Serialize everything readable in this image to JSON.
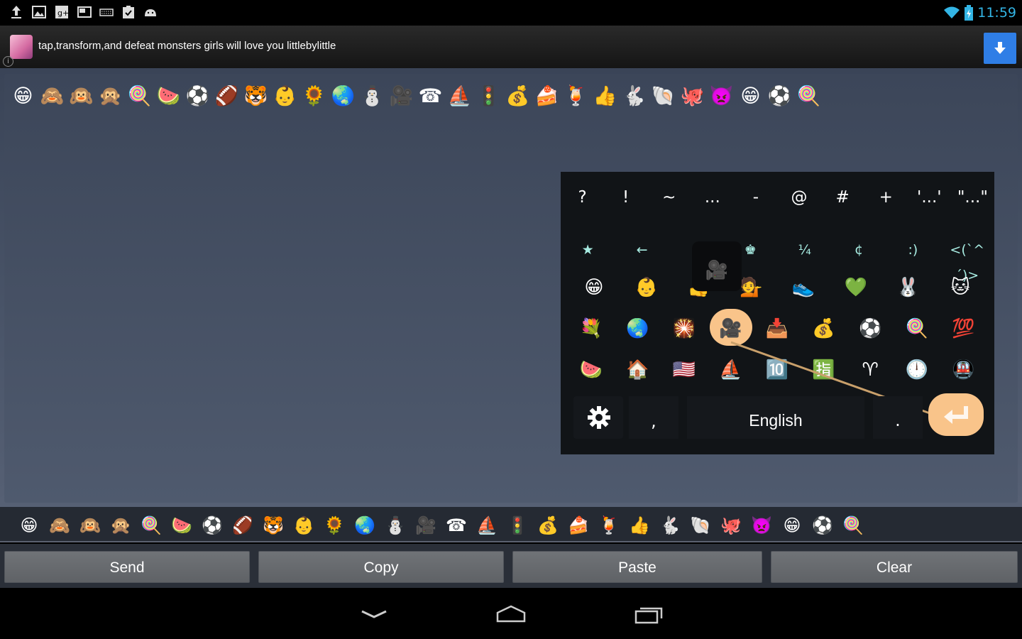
{
  "status_bar": {
    "left_icons": [
      "upload-icon",
      "image-icon",
      "google-plus-icon",
      "screen-icon",
      "keyboard-icon",
      "clipboard-check-icon",
      "android-icon"
    ],
    "time": "11:59",
    "accent_color": "#33b5e5"
  },
  "ad": {
    "text": "tap,transform,and defeat monsters girls will love you littlebylittle",
    "info_label": "i",
    "download_color": "#2f7ee6"
  },
  "message": {
    "emoji": [
      "😁",
      "🙈",
      "🙉",
      "🙊",
      "🍭",
      "🍉",
      "⚽",
      "🏈",
      "🐯",
      "👶",
      "🌻",
      "🌏",
      "⛄",
      "🎥",
      "☎",
      "⛵",
      "🚦",
      "💰",
      "🍰",
      "🍹",
      "👍",
      "🐇",
      "🐚",
      "🐙",
      "👿",
      "😁",
      "⚽",
      "🍭"
    ]
  },
  "keyboard": {
    "punct_keys": [
      "?",
      "!",
      "~",
      "...",
      "-",
      "@",
      "#",
      "+",
      "'...'",
      "\"...\""
    ],
    "symbol_keys": [
      "★",
      "←",
      "↖",
      "♚",
      "¼",
      "¢",
      ":)",
      "<(`^´)>"
    ],
    "emoji_row_1": [
      "😁",
      "👶",
      "👍",
      "💁",
      "👟",
      "💚",
      "🐰",
      "🐱"
    ],
    "emoji_row_2": [
      "💐",
      "🌏",
      "🎇",
      "🎥",
      "📥",
      "💰",
      "⚽",
      "🍭",
      "💯"
    ],
    "emoji_row_3": [
      "🍉",
      "🏠",
      "🇺🇸",
      "⛵",
      "🔟",
      "🈯",
      "♈",
      "🕛",
      "🚇"
    ],
    "popup_glyph": "🎥",
    "space_label": "English",
    "comma_label": ",",
    "period_label": ".",
    "highlight_color": "#f9c48a"
  },
  "emoji_tabs": [
    "😁",
    "🙈",
    "🙉",
    "🙊",
    "🍭",
    "🍉",
    "⚽",
    "🏈",
    "🐯",
    "👶",
    "🌻",
    "🌏",
    "⛄",
    "🎥",
    "☎",
    "⛵",
    "🚦",
    "💰",
    "🍰",
    "🍹",
    "👍",
    "🐇",
    "🐚",
    "🐙",
    "👿",
    "😁",
    "⚽",
    "🍭"
  ],
  "actions": {
    "send": "Send",
    "copy": "Copy",
    "paste": "Paste",
    "clear": "Clear"
  },
  "nav_bar": {
    "icons": [
      "back-icon",
      "home-icon",
      "recent-apps-icon"
    ]
  }
}
